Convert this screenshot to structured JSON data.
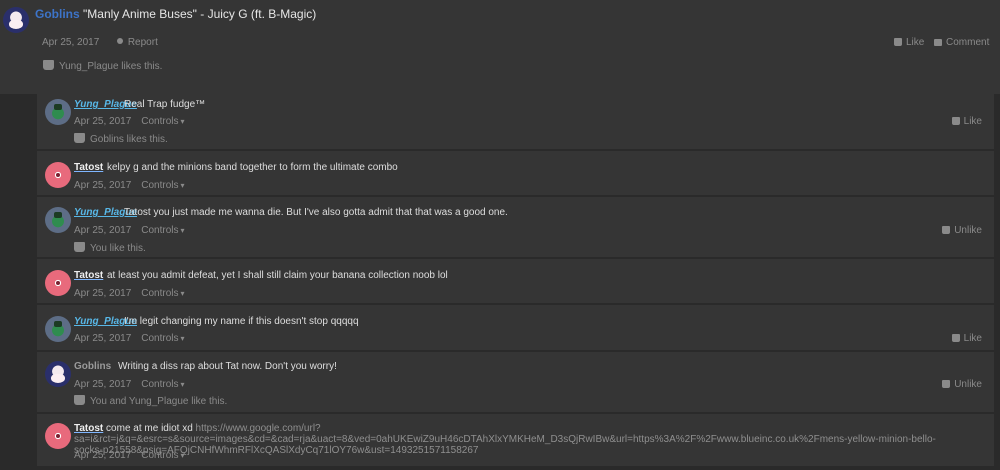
{
  "post": {
    "author": "Goblins",
    "title": "\"Manly Anime Buses\" - Juicy G (ft. B-Magic)",
    "date": "Apr 25, 2017",
    "report_label": "Report",
    "like_label": "Like",
    "comment_label": "Comment",
    "likes_text": "Yung_Plague likes this."
  },
  "comments": [
    {
      "author": "Yung_Plague",
      "text": "Real Trap fudge™",
      "date": "Apr 25, 2017",
      "controls": "Controls",
      "action": "Like",
      "likes": "Goblins likes this."
    },
    {
      "author": "Tatost",
      "text": "kelpy g and the minions band together to form the ultimate combo",
      "date": "Apr 25, 2017",
      "controls": "Controls"
    },
    {
      "author": "Yung_Plague",
      "text": "Tatost you just made me wanna die. But I've also gotta admit that that was a good one.",
      "date": "Apr 25, 2017",
      "controls": "Controls",
      "action": "Unlike",
      "likes": "You like this."
    },
    {
      "author": "Tatost",
      "text": "at least you admit defeat, yet I shall still claim your banana collection noob lol",
      "date": "Apr 25, 2017",
      "controls": "Controls"
    },
    {
      "author": "Yung_Plague",
      "text": "I'm legit changing my name if this doesn't stop qqqqq",
      "date": "Apr 25, 2017",
      "controls": "Controls",
      "action": "Like"
    },
    {
      "author": "Goblins",
      "text": "Writing a diss rap about Tat now. Don't you worry!",
      "date": "Apr 25, 2017",
      "controls": "Controls",
      "action": "Unlike",
      "likes": "You and Yung_Plague like this."
    },
    {
      "author": "Tatost",
      "text_prefix": "come at me idiot xd",
      "text_url": "https://www.google.com/url?sa=i&rct=j&q=&esrc=s&source=images&cd=&cad=rja&uact=8&ved=0ahUKEwiZ9uH46cDTAhXlxYMKHeM_D3sQjRwIBw&url=https%3A%2F%2Fwww.blueinc.co.uk%2Fmens-yellow-minion-bello-socks-p21558&psig=AFQjCNHfWhmRFlXcQASlXdyCq71lOY76w&ust=1493251571158267",
      "date": "Apr 25, 2017",
      "controls": "Controls"
    }
  ]
}
